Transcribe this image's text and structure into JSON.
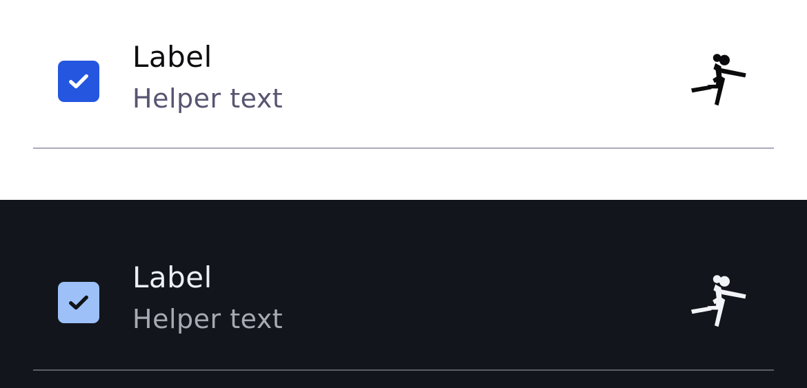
{
  "colors": {
    "light_background": "#ffffff",
    "dark_background": "#12151c",
    "light_checkbox_fill": "#2456e0",
    "dark_checkbox_fill": "#9dc0f8",
    "light_check_mark": "#ffffff",
    "dark_check_mark": "#111318",
    "light_label": "#0d0d10",
    "light_helper": "#585572",
    "dark_label": "#eef0f6",
    "dark_helper": "#a7a9b4"
  },
  "light_item": {
    "label": "Label",
    "helper_text": "Helper text",
    "checked": true,
    "leading_icon": "checkbox-checked-icon",
    "trailing_icon": "sports-handball-icon"
  },
  "dark_item": {
    "label": "Label",
    "helper_text": "Helper text",
    "checked": true,
    "leading_icon": "checkbox-checked-icon",
    "trailing_icon": "sports-handball-icon"
  }
}
